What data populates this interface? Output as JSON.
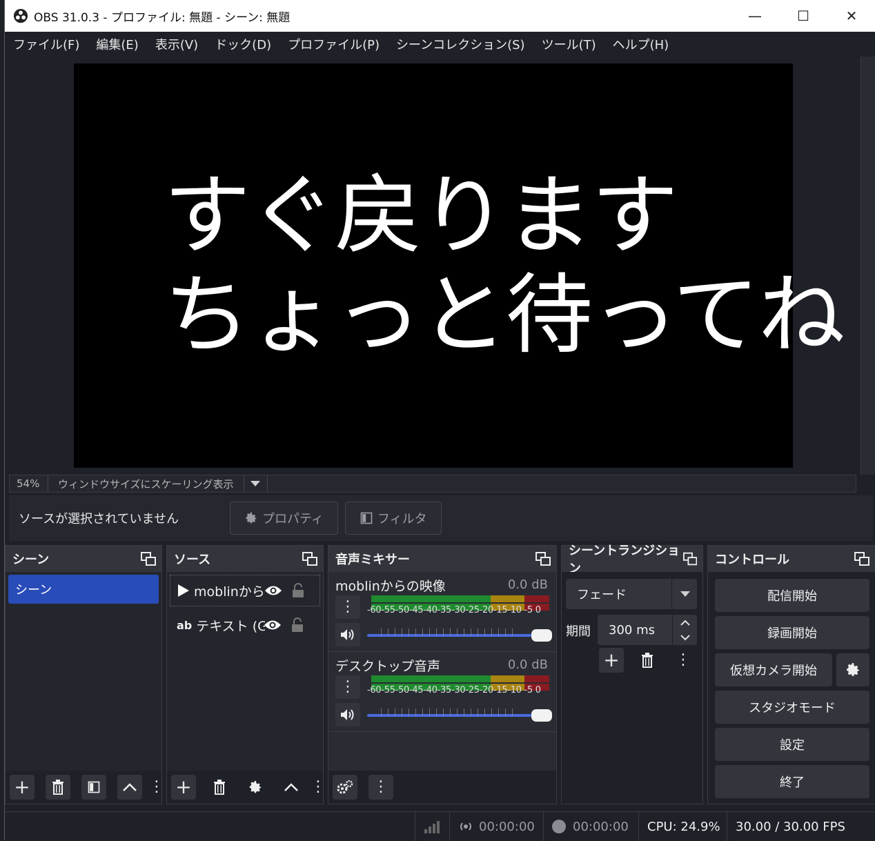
{
  "window": {
    "title": "OBS 31.0.3 - プロファイル: 無題 - シーン: 無題",
    "minimize": "—",
    "maximize": "☐",
    "close": "✕"
  },
  "menu": [
    "ファイル(F)",
    "編集(E)",
    "表示(V)",
    "ドック(D)",
    "プロファイル(P)",
    "シーンコレクション(S)",
    "ツール(T)",
    "ヘルプ(H)"
  ],
  "preview": {
    "line1": "すぐ戻ります",
    "line2": "ちょっと待ってね",
    "zoom": "54%",
    "scale_mode": "ウィンドウサイズにスケーリング表示"
  },
  "context": {
    "no_selection": "ソースが選択されていません",
    "properties": "プロパティ",
    "filters": "フィルタ"
  },
  "scenes": {
    "title": "シーン",
    "items": [
      "シーン"
    ]
  },
  "sources": {
    "title": "ソース",
    "items": [
      {
        "icon": "play",
        "name": "moblinから"
      },
      {
        "icon": "ab",
        "name": "テキスト (GDI+)"
      }
    ]
  },
  "mixer": {
    "title": "音声ミキサー",
    "scale": "-60-55-50-45-40-35-30-25-20-15-10 -5  0",
    "channels": [
      {
        "name": "moblinからの映像",
        "db": "0.0 dB"
      },
      {
        "name": "デスクトップ音声",
        "db": "0.0 dB"
      }
    ]
  },
  "transitions": {
    "title": "シーントランジション",
    "selected": "フェード",
    "duration_label": "期間",
    "duration": "300 ms"
  },
  "controls": {
    "title": "コントロール",
    "buttons": [
      "配信開始",
      "録画開始",
      "仮想カメラ開始",
      "スタジオモード",
      "設定",
      "終了"
    ]
  },
  "status": {
    "stream_time": "00:00:00",
    "rec_time": "00:00:00",
    "cpu": "CPU: 24.9%",
    "fps": "30.00 / 30.00 FPS"
  }
}
